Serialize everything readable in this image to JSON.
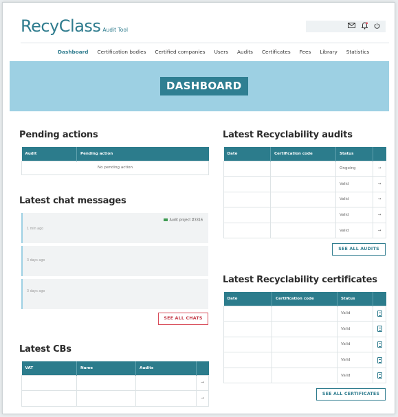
{
  "app": {
    "logo": "RecyClass",
    "subtitle": "Audit Tool"
  },
  "top_actions": {
    "icons": [
      "mail-icon",
      "bell-icon",
      "power-icon"
    ]
  },
  "nav": {
    "items": [
      "Dashboard",
      "Certification bodies",
      "Certified companies",
      "Users",
      "Audits",
      "Certificates",
      "Fees",
      "Library",
      "Statistics"
    ],
    "active": "Dashboard"
  },
  "banner": {
    "title": "DASHBOARD"
  },
  "pending": {
    "title": "Pending actions",
    "columns": [
      "Audit",
      "Pending action"
    ],
    "empty": "No pending action"
  },
  "chats": {
    "title": "Latest chat messages",
    "messages": [
      {
        "time": "1 min ago",
        "tag": "Audit project #3316"
      },
      {
        "time": "3 days ago",
        "tag": ""
      },
      {
        "time": "3 days ago",
        "tag": ""
      }
    ],
    "see_all": "SEE ALL CHATS"
  },
  "cbs": {
    "title": "Latest CBs",
    "columns": [
      "VAT",
      "Name",
      "Audits"
    ],
    "rows": [
      {
        "vat": "",
        "name": "",
        "audits": ""
      },
      {
        "vat": "",
        "name": "",
        "audits": ""
      }
    ]
  },
  "audits": {
    "title": "Latest Recyclability audits",
    "columns": [
      "Date",
      "Certification code",
      "Status"
    ],
    "rows": [
      {
        "date": "",
        "code": "",
        "status": "Ongoing"
      },
      {
        "date": "",
        "code": "",
        "status": "Valid"
      },
      {
        "date": "",
        "code": "",
        "status": "Valid"
      },
      {
        "date": "",
        "code": "",
        "status": "Valid"
      },
      {
        "date": "",
        "code": "",
        "status": "Valid"
      }
    ],
    "see_all": "SEE ALL AUDITS"
  },
  "certificates": {
    "title": "Latest Recyclability certificates",
    "columns": [
      "Date",
      "Certification code",
      "Status"
    ],
    "rows": [
      {
        "date": "",
        "code": "",
        "status": "Valid"
      },
      {
        "date": "",
        "code": "",
        "status": "Valid"
      },
      {
        "date": "",
        "code": "",
        "status": "Valid"
      },
      {
        "date": "",
        "code": "",
        "status": "Valid"
      },
      {
        "date": "",
        "code": "",
        "status": "Valid"
      }
    ],
    "see_all": "SEE ALL CERTIFICATES"
  },
  "colors": {
    "brand": "#2f7c8e",
    "banner": "#9dd0e3",
    "table_header": "#2c7c8c",
    "danger": "#d84a58"
  }
}
